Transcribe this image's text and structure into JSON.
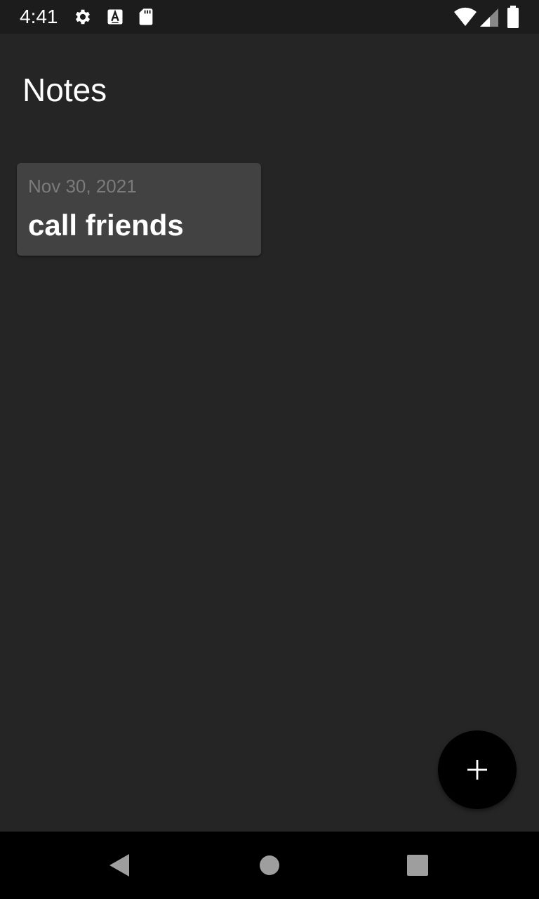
{
  "status_bar": {
    "time": "4:41",
    "icons": [
      "gear-icon",
      "a-notification-icon",
      "sd-card-icon",
      "wifi-icon",
      "signal-icon",
      "battery-icon"
    ]
  },
  "header": {
    "title": "Notes"
  },
  "notes": [
    {
      "date": "Nov 30, 2021",
      "title": "call friends"
    }
  ],
  "fab": {
    "icon": "plus-icon"
  },
  "nav_bar": {
    "icons": [
      "back-icon",
      "home-icon",
      "recents-icon"
    ]
  },
  "colors": {
    "background": "#252525",
    "card": "#424242",
    "date_text": "#7b7b7b",
    "fab": "#000000"
  }
}
